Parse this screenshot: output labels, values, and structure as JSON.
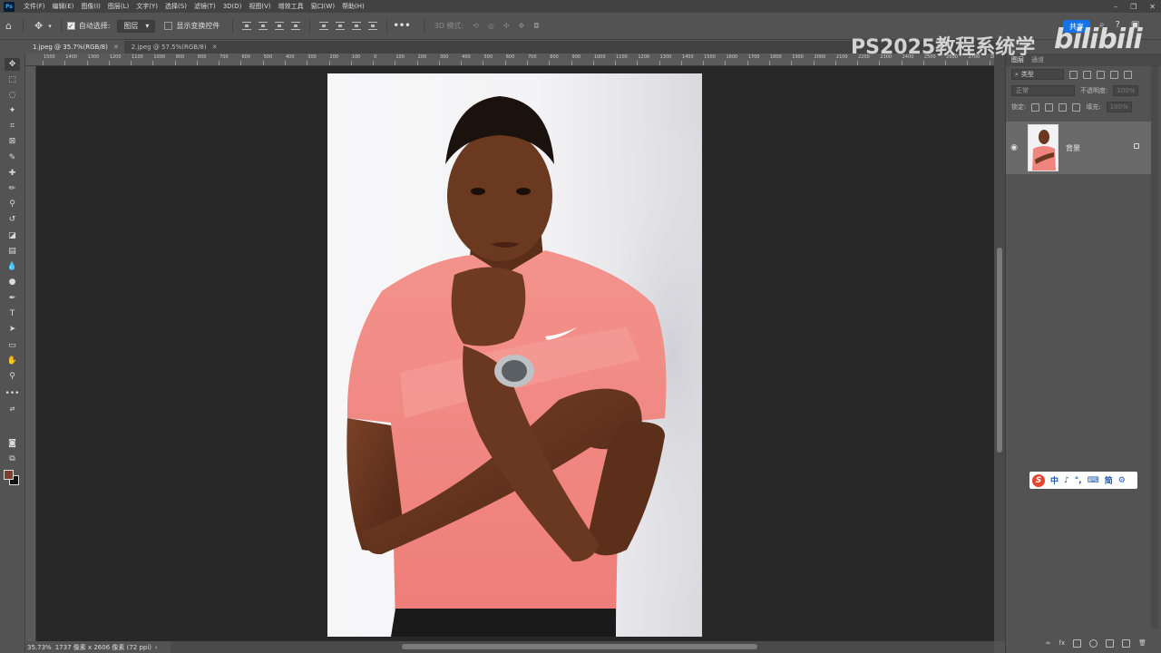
{
  "menu": {
    "logo": "Ps",
    "items": [
      "文件(F)",
      "编辑(E)",
      "图像(I)",
      "图层(L)",
      "文字(Y)",
      "选择(S)",
      "滤镜(T)",
      "3D(D)",
      "视图(V)",
      "增效工具",
      "窗口(W)",
      "帮助(H)"
    ]
  },
  "options": {
    "auto_select_label": "自动选择:",
    "auto_select_checked": true,
    "target_value": "图层",
    "show_transform_label": "显示变换控件",
    "mode_3d_label": "3D 模式:",
    "share_label": "共享"
  },
  "watermark": {
    "text": "PS2025教程系统学",
    "logo": "bilibili"
  },
  "tabs": [
    {
      "label": "1.jpeg @ 35.7%(RGB/8)",
      "active": true
    },
    {
      "label": "2.jpeg @ 57.5%(RGB/8)",
      "active": false
    }
  ],
  "ruler": {
    "top_ticks": [
      "1500",
      "1400",
      "1300",
      "1200",
      "1100",
      "1000",
      "900",
      "800",
      "700",
      "600",
      "500",
      "400",
      "300",
      "200",
      "100",
      "0",
      "100",
      "200",
      "300",
      "400",
      "500",
      "600",
      "700",
      "800",
      "900",
      "1000",
      "1100",
      "1200",
      "1300",
      "1400",
      "1500",
      "1600",
      "1700",
      "1800",
      "1900",
      "2000",
      "2100",
      "2200",
      "2300",
      "2400",
      "2500",
      "2600",
      "2700",
      "2800"
    ]
  },
  "status": {
    "zoom": "35.73%",
    "doc_info": "1737 像素 x 2606 像素 (72 ppi)"
  },
  "layers_panel": {
    "tabs": [
      "图层",
      "通道"
    ],
    "kind_label": "类型",
    "blend_mode": "正常",
    "opacity_label": "不透明度:",
    "opacity_value": "100%",
    "lock_label": "锁定:",
    "fill_label": "填充:",
    "fill_value": "100%",
    "layer_name": "背景"
  },
  "ime": {
    "items": [
      "中",
      "♪",
      "°,",
      "⌨",
      "简",
      "⚙"
    ]
  },
  "colors": {
    "foreground": "#7b4030",
    "background": "#111111",
    "shirt": "#f0857f",
    "skin": "#6b3a22"
  }
}
